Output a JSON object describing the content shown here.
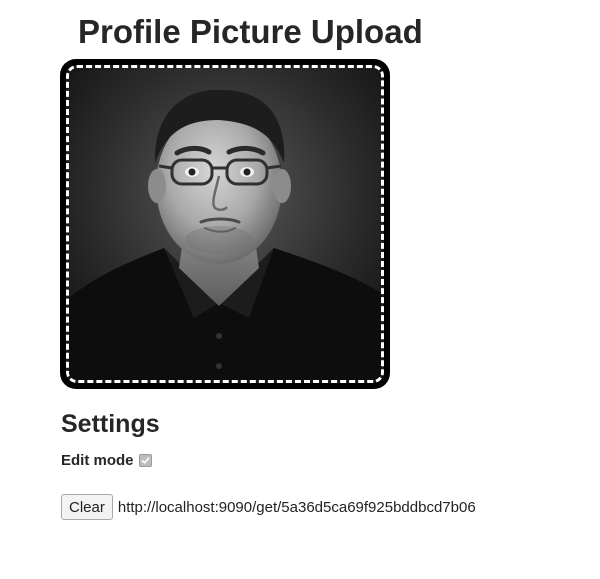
{
  "page": {
    "title": "Profile Picture Upload"
  },
  "profile_picture": {
    "alt": "profile picture",
    "checked_icon": "check-icon"
  },
  "settings": {
    "heading": "Settings",
    "edit_mode_label": "Edit mode",
    "edit_mode_checked": true
  },
  "actions": {
    "clear_label": "Clear",
    "image_url": "http://localhost:9090/get/5a36d5ca69f925bddbcd7b06"
  },
  "colors": {
    "frame": "#000000",
    "dashed_border": "#ffffff",
    "text": "#262626"
  }
}
